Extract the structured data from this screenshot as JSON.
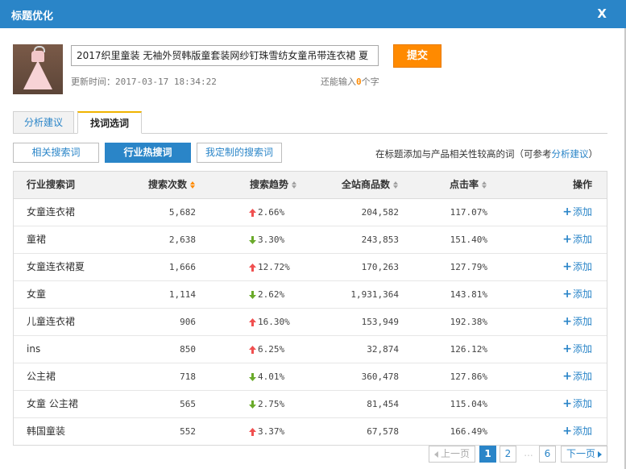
{
  "dialog": {
    "title": "标题优化",
    "close_label": "X"
  },
  "product": {
    "title_value": "2017织里童装 无袖外贸韩版童套装网纱钉珠雪纺女童吊带连衣裙 夏",
    "submit_label": "提交",
    "update_label": "更新时间：",
    "update_time": "2017-03-17 18:34:22",
    "remain_prefix": "还能输入",
    "remain_count": "0",
    "remain_suffix": "个字"
  },
  "tabs": [
    {
      "label": "分析建议"
    },
    {
      "label": "找词选词"
    }
  ],
  "subtabs": [
    {
      "label": "相关搜索词"
    },
    {
      "label": "行业热搜词"
    },
    {
      "label": "我定制的搜索词"
    }
  ],
  "hint": {
    "text": "在标题添加与产品相关性较高的词（可参考",
    "link": "分析建议",
    "end": "）"
  },
  "table": {
    "headers": {
      "keyword": "行业搜索词",
      "search_count": "搜索次数",
      "trend": "搜索趋势",
      "items": "全站商品数",
      "ctr": "点击率",
      "op": "操作"
    },
    "add_label": "添加",
    "rows": [
      {
        "keyword": "女童连衣裙",
        "search_count": "5,682",
        "trend_dir": "up",
        "trend": "2.66%",
        "items": "204,582",
        "ctr": "117.07%"
      },
      {
        "keyword": "童裙",
        "search_count": "2,638",
        "trend_dir": "down",
        "trend": "3.30%",
        "items": "243,853",
        "ctr": "151.40%"
      },
      {
        "keyword": "女童连衣裙夏",
        "search_count": "1,666",
        "trend_dir": "up",
        "trend": "12.72%",
        "items": "170,263",
        "ctr": "127.79%"
      },
      {
        "keyword": "女童",
        "search_count": "1,114",
        "trend_dir": "down",
        "trend": "2.62%",
        "items": "1,931,364",
        "ctr": "143.81%"
      },
      {
        "keyword": "儿童连衣裙",
        "search_count": "906",
        "trend_dir": "up",
        "trend": "16.30%",
        "items": "153,949",
        "ctr": "192.38%"
      },
      {
        "keyword": "ins",
        "search_count": "850",
        "trend_dir": "up",
        "trend": "6.25%",
        "items": "32,874",
        "ctr": "126.12%"
      },
      {
        "keyword": "公主裙",
        "search_count": "718",
        "trend_dir": "down",
        "trend": "4.01%",
        "items": "360,478",
        "ctr": "127.86%"
      },
      {
        "keyword": "女童 公主裙",
        "search_count": "565",
        "trend_dir": "down",
        "trend": "2.75%",
        "items": "81,454",
        "ctr": "115.04%"
      },
      {
        "keyword": "韩国童装",
        "search_count": "552",
        "trend_dir": "up",
        "trend": "3.37%",
        "items": "67,578",
        "ctr": "166.49%"
      }
    ]
  },
  "pagination": {
    "prev_label": "上一页",
    "pages": [
      "1",
      "2",
      "6"
    ],
    "ellipsis": "...",
    "next_label": "下一页",
    "current": "1"
  },
  "colors": {
    "primary": "#2a85c8",
    "accent": "#ff8a00",
    "trend_up": "#f05050",
    "trend_down": "#6aaa2a"
  }
}
